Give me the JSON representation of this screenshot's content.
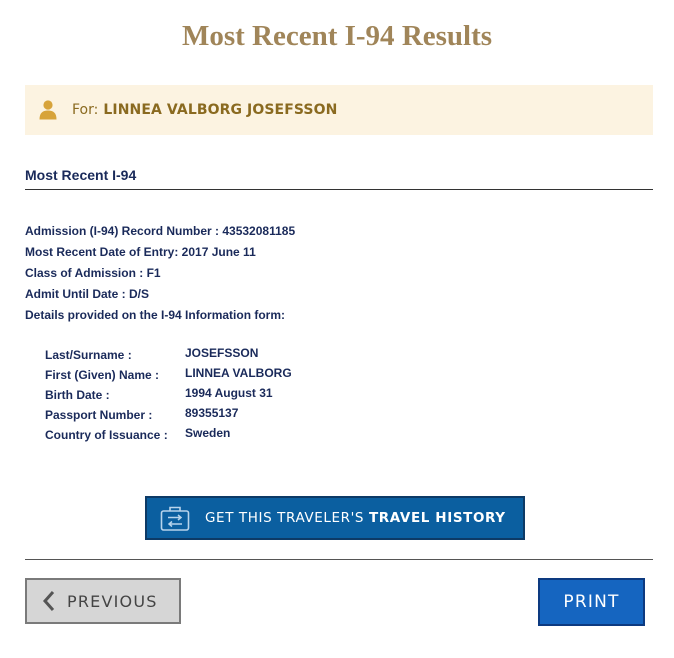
{
  "header": {
    "title_bold": "Most Recent I-94",
    "title_rest": "Results"
  },
  "traveler": {
    "for_label": "For:",
    "name": "LINNEA VALBORG JOSEFSSON",
    "icon": "person-icon"
  },
  "section": {
    "heading": "Most Recent I-94"
  },
  "record": [
    "Admission (I-94) Record Number : 43532081185",
    "Most Recent Date of Entry: 2017 June 11",
    "Class of Admission : F1",
    "Admit Until Date : D/S",
    "Details provided on the I-94 Information form:"
  ],
  "details": [
    {
      "label": "Last/Surname :",
      "value": "JOSEFSSON"
    },
    {
      "label": "First (Given) Name :",
      "value": "LINNEA VALBORG"
    },
    {
      "label": "Birth Date :",
      "value": "1994 August 31"
    },
    {
      "label": "Passport Number :",
      "value": "89355137"
    },
    {
      "label": "Country of Issuance :",
      "value": "Sweden"
    }
  ],
  "travel_history_button": {
    "label_prefix": "GET THIS TRAVELER'S ",
    "label_bold": "TRAVEL HISTORY",
    "icon": "suitcase-icon"
  },
  "footer": {
    "previous_label": "PREVIOUS",
    "print_label": "PRINT"
  },
  "colors": {
    "title": "#a08559",
    "banner_bg": "#fcf3e1",
    "banner_text": "#8a6a20",
    "text": "#1a2a5a",
    "travel_button": "#0b5fa0",
    "print_button": "#1565c0",
    "previous_button": "#d6d6d6"
  }
}
